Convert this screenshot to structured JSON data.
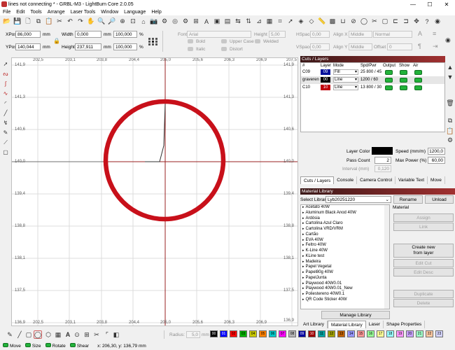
{
  "window": {
    "title": "lines not connecting * - GRBL-M3 - LightBurn Core 2.0.05",
    "minimize": "—",
    "maximize": "☐",
    "close": "✕"
  },
  "menu": [
    "File",
    "Edit",
    "Tools",
    "Arrange",
    "Laser Tools",
    "Window",
    "Language",
    "Help"
  ],
  "toolbar1": {
    "icons": [
      "folder-open-icon",
      "save-icon",
      "new-file-icon",
      "copy-icon",
      "paste-icon",
      "cut-icon",
      "undo-icon",
      "redo-icon",
      "pan-icon",
      "zoom-in-icon",
      "zoom-out-icon",
      "zoom-window-icon",
      "zoom-page-icon",
      "trace-icon",
      "camera-icon",
      "camera-settings-icon",
      "offset-icon",
      "settings-icon",
      "align-icon",
      "text-icon",
      "group-icon",
      "ungroup-icon",
      "flip-h-icon",
      "flip-v-icon",
      "mirror-icon",
      "array-icon",
      "snap-icon",
      "pointer-icon",
      "boolean-icon",
      "node-icon",
      "measure-icon",
      "fill-icon",
      "weld-icon",
      "break-icon",
      "close-path-icon",
      "trim-icon",
      "cut-shape-icon",
      "crop-icon",
      "dock-icon",
      "move-icon",
      "help-icon",
      "laser-icon"
    ]
  },
  "toolbar2": {
    "xpos_label": "XPos",
    "xpos": "86,000",
    "ypos_label": "YPos",
    "ypos": "140,044",
    "mm": "mm",
    "width_label": "Width",
    "width": "0,000",
    "height_label": "Height",
    "height": "237,911",
    "wpct": "100,000",
    "hpct": "100,000",
    "pct": "%",
    "font_label": "Font",
    "font": "Arial",
    "fheight_label": "Height",
    "fheight": "5,00",
    "hspace_label": "HSpace",
    "hspace": "0,00",
    "alignx_label": "Align X",
    "alignx": "Middle",
    "normal": "Normal",
    "vspace_label": "VSpace",
    "vspace": "0,00",
    "aligny_label": "Align Y",
    "aligny": "Middle",
    "offset_label": "Offset",
    "offset": "0",
    "bold": "Bold",
    "italic": "Italic",
    "uppercase": "Upper Case",
    "distort": "Distort",
    "welded": "Welded"
  },
  "ruler_top": [
    "202,5",
    "203,1",
    "203,8",
    "204,4",
    "205,0",
    "205,6",
    "206,3",
    "206,9",
    "207,5"
  ],
  "ruler_left": [
    "141,9",
    "141,3",
    "140,6",
    "140,0",
    "139,4",
    "138,8",
    "138,1",
    "137,5",
    "136,9"
  ],
  "ruler_bottom": [
    "202,5",
    "203,1",
    "203,8",
    "204,4",
    "205,0",
    "205,6",
    "206,3",
    "206,9",
    "207,5"
  ],
  "ruler_right": [
    "141,9",
    "141,3",
    "140,6",
    "140,0",
    "139,4",
    "138,8",
    "138,1",
    "137,5",
    "136,9"
  ],
  "cuts": {
    "title": "Cuts / Layers",
    "headers": [
      "#",
      "Layer",
      "Mode",
      "Spd/Pwr",
      "Output",
      "Show",
      "Air"
    ],
    "rows": [
      {
        "num": "C09",
        "layer": "09",
        "mode": "Fill",
        "spd": "25 800 / 45",
        "color": "#00109a"
      },
      {
        "num": "graveren",
        "layer": "00",
        "mode": "Line",
        "spd": "1200 / 60",
        "color": "#000000"
      },
      {
        "num": "C10",
        "layer": "10",
        "mode": "Line",
        "spd": "13 800 / 30",
        "color": "#c0000a"
      }
    ],
    "layer_color_label": "Layer Color",
    "speed_label": "Speed (mm/m)",
    "speed": "1200,0",
    "pass_label": "Pass Count",
    "pass": "2",
    "maxpower_label": "Max Power (%)",
    "maxpower": "60,00",
    "interval_label": "Interval (mm)",
    "interval": "0,120"
  },
  "right_icons": [
    "arrow-up-icon",
    "arrow-down-icon",
    "delete-icon",
    "copy-layer-icon",
    "paste-layer-icon",
    "options-icon"
  ],
  "tabs1": [
    "Cuts / Layers",
    "Console",
    "Camera Control",
    "Variable Text",
    "Move"
  ],
  "material": {
    "title": "Material Library",
    "select_label": "Select Library",
    "library": "Lyb20251220",
    "rename": "Rename",
    "unload": "Unload",
    "material_label": "Material",
    "items": [
      "Acetato 40W",
      "Aluminum Black Anod 40W",
      "Ardósia",
      "Cartolina Azul Claro",
      "Cartolina VRD/VRM",
      "Cartão",
      "EVA 40W",
      "Feltro 40W",
      "K-Line 40W",
      "KLine test",
      "Madeira",
      "Papel Vegetal",
      "Papel80g 40W",
      "PapelJunta",
      "Playwood 40W0.01",
      "Playwood 40W0.01_New",
      "Poliestereno 40W0.1",
      "QR Code Sticker 40W"
    ],
    "buttons": {
      "assign": "Assign",
      "link": "Link",
      "create": "Create new\nfrom layer",
      "edit_cut": "Edit Cut",
      "edit_desc": "Edit Desc",
      "duplicate": "Duplicate",
      "delete": "Delete"
    },
    "manage": "Manage Library"
  },
  "tabs2": [
    "Art Library",
    "Material Library",
    "Laser",
    "Shape Properties"
  ],
  "bottom_tools": {
    "radius_label": "Radius:",
    "radius": "5,0",
    "mm": "mm"
  },
  "palette": [
    {
      "label": "00",
      "color": "#000000"
    },
    {
      "label": "01",
      "color": "#0000ff"
    },
    {
      "label": "02",
      "color": "#ff0000"
    },
    {
      "label": "03",
      "color": "#00b000"
    },
    {
      "label": "04",
      "color": "#c8c800"
    },
    {
      "label": "05",
      "color": "#ff8000"
    },
    {
      "label": "06",
      "color": "#00c8c8"
    },
    {
      "label": "07",
      "color": "#ff00ff"
    },
    {
      "label": "08",
      "color": "#b4b4b4"
    },
    {
      "label": "09",
      "color": "#0000a0"
    },
    {
      "label": "10",
      "color": "#a00000"
    },
    {
      "label": "11",
      "color": "#00a0a0"
    },
    {
      "label": "12",
      "color": "#a0a000"
    },
    {
      "label": "13",
      "color": "#c06000"
    },
    {
      "label": "14",
      "color": "#9696ff"
    },
    {
      "label": "15",
      "color": "#ff9696"
    },
    {
      "label": "16",
      "color": "#96ff96"
    },
    {
      "label": "17",
      "color": "#ffff96"
    },
    {
      "label": "18",
      "color": "#96ffff"
    },
    {
      "label": "19",
      "color": "#ff96ff"
    },
    {
      "label": "20",
      "color": "#c8a0ff"
    },
    {
      "label": "21",
      "color": "#a0ffc8"
    },
    {
      "label": "22",
      "color": "#ffc8a0"
    },
    {
      "label": "23",
      "color": "#d4d4ff"
    }
  ],
  "status": {
    "move": "Move",
    "size": "Size",
    "rotate": "Rotate",
    "shear": "Shear",
    "coords": "x: 206,30, y: 136,79 mm"
  }
}
